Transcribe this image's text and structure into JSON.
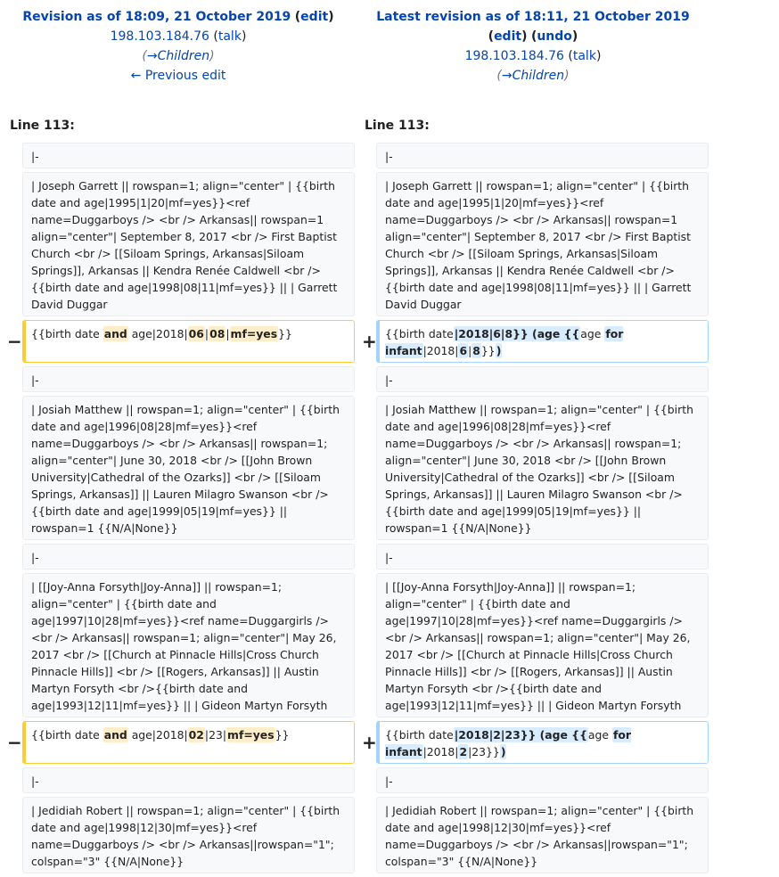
{
  "left_header": {
    "title": "Revision as of 18:09, 21 October 2019",
    "edit_label": "edit",
    "user": "198.103.184.76",
    "talk_label": "talk",
    "summary": "→Children",
    "prev_edit": "← Previous edit"
  },
  "right_header": {
    "title": "Latest revision as of 18:11, 21 October 2019",
    "edit_label": "edit",
    "undo_label": "undo",
    "user": "198.103.184.76",
    "talk_label": "talk",
    "summary": "→Children"
  },
  "line_label_left": "Line 113:",
  "line_label_right": "Line 113:",
  "markers": {
    "minus": "−",
    "plus": "+"
  },
  "rows": [
    {
      "type": "context",
      "left": "|-",
      "right": "|-"
    },
    {
      "type": "context",
      "left": "| Joseph Garrett || rowspan=1; align=\"center\" | {{birth date and age|1995|1|20|mf=yes}}<ref name=Duggarboys /> <br /> Arkansas|| rowspan=1 align=\"center\"|  September 8, 2017 <br /> First Baptist Church <br /> [[Siloam Springs, Arkansas|Siloam Springs]], Arkansas || Kendra Renée Caldwell <br /> {{birth date and age|1998|08|11|mf=yes}} || | Garrett David Duggar",
      "right": "| Joseph Garrett || rowspan=1; align=\"center\" | {{birth date and age|1995|1|20|mf=yes}}<ref name=Duggarboys /> <br /> Arkansas|| rowspan=1 align=\"center\"|  September 8, 2017 <br /> First Baptist Church <br /> [[Siloam Springs, Arkansas|Siloam Springs]], Arkansas || Kendra Renée Caldwell <br /> {{birth date and age|1998|08|11|mf=yes}} || | Garrett David Duggar"
    },
    {
      "type": "change",
      "left": [
        "{{birth date ",
        "*and",
        " age|2018|",
        "*06",
        "|",
        "*08",
        "|",
        "*mf=yes",
        "}} "
      ],
      "right": [
        "{{birth date",
        "*|2018|6|8}} (age {{",
        "age ",
        "*for infant",
        "|2018|",
        "*6",
        "|",
        "*8",
        "}}",
        "*)"
      ]
    },
    {
      "type": "context",
      "left": "|-",
      "right": "|-"
    },
    {
      "type": "context",
      "left": "| Josiah Matthew || rowspan=1; align=\"center\" | {{birth date and age|1996|08|28|mf=yes}}<ref name=Duggarboys /> <br /> Arkansas|| rowspan=1; align=\"center\"| June 30, 2018 <br /> [[John Brown University|Cathedral of the Ozarks]] <br /> [[Siloam Springs, Arkansas]] || Lauren Milagro Swanson <br /> {{birth date and age|1999|05|19|mf=yes}} || rowspan=1 {{N/A|None}}",
      "right": "| Josiah Matthew || rowspan=1; align=\"center\" | {{birth date and age|1996|08|28|mf=yes}}<ref name=Duggarboys /> <br /> Arkansas|| rowspan=1; align=\"center\"| June 30, 2018 <br /> [[John Brown University|Cathedral of the Ozarks]] <br /> [[Siloam Springs, Arkansas]] || Lauren Milagro Swanson <br /> {{birth date and age|1999|05|19|mf=yes}} || rowspan=1 {{N/A|None}}"
    },
    {
      "type": "context",
      "left": "|-",
      "right": "|-"
    },
    {
      "type": "context",
      "left": "| [[Joy-Anna Forsyth|Joy-Anna]] || rowspan=1; align=\"center\" | {{birth date and age|1997|10|28|mf=yes}}<ref name=Duggargirls /> <br /> Arkansas|| rowspan=1; align=\"center\"| May 26, 2017 <br /> [[Church at Pinnacle Hills|Cross Church Pinnacle Hills]] <br /> [[Rogers, Arkansas]] || Austin Martyn Forsyth  <br />{{birth date and age|1993|12|11|mf=yes}} || | Gideon Martyn Forsyth",
      "right": "| [[Joy-Anna Forsyth|Joy-Anna]] || rowspan=1; align=\"center\" | {{birth date and age|1997|10|28|mf=yes}}<ref name=Duggargirls /> <br /> Arkansas|| rowspan=1; align=\"center\"| May 26, 2017 <br /> [[Church at Pinnacle Hills|Cross Church Pinnacle Hills]] <br /> [[Rogers, Arkansas]] || Austin Martyn Forsyth  <br />{{birth date and age|1993|12|11|mf=yes}} || | Gideon Martyn Forsyth"
    },
    {
      "type": "change",
      "left": [
        "{{birth date ",
        "*and",
        " age|2018|",
        "*02",
        "|23|",
        "*mf=yes",
        "}}"
      ],
      "right": [
        "{{birth date",
        "*|2018|2|23}} (age {{",
        "age ",
        "*for infant",
        "|2018|",
        "*2",
        "|23}}",
        "*)"
      ]
    },
    {
      "type": "context",
      "left": "|-",
      "right": "|-"
    },
    {
      "type": "context",
      "left": "| Jedidiah Robert || rowspan=1; align=\"center\" | {{birth date and age|1998|12|30|mf=yes}}<ref name=Duggarboys /> <br /> Arkansas||rowspan=\"1\"; colspan=\"3\" {{N/A|None}}",
      "right": "| Jedidiah Robert || rowspan=1; align=\"center\" | {{birth date and age|1998|12|30|mf=yes}}<ref name=Duggarboys /> <br /> Arkansas||rowspan=\"1\"; colspan=\"3\" {{N/A|None}}"
    }
  ]
}
